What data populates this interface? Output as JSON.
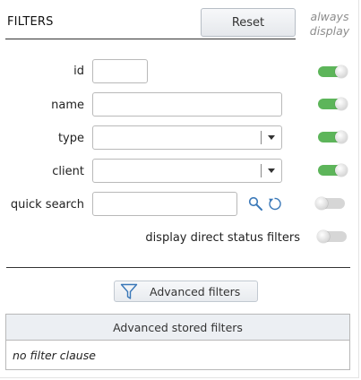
{
  "header": {
    "title": "FILTERS",
    "reset_label": "Reset",
    "always_display_line1": "always",
    "always_display_line2": "display"
  },
  "fields": {
    "id": {
      "label": "id",
      "value": "",
      "always_display": true
    },
    "name": {
      "label": "name",
      "value": "",
      "always_display": true
    },
    "type": {
      "label": "type",
      "selected": "",
      "always_display": true
    },
    "client": {
      "label": "client",
      "selected": "",
      "always_display": true
    },
    "quick_search": {
      "label": "quick search",
      "value": "",
      "always_display": false
    }
  },
  "direct_status": {
    "label": "display direct status filters",
    "enabled": false
  },
  "advanced": {
    "button_label": "Advanced filters"
  },
  "stored_filters": {
    "header": "Advanced stored filters",
    "empty_text": "no filter clause"
  },
  "icons": {
    "search": "magnifier-icon",
    "reset_search": "refresh-icon",
    "advanced": "funnel-icon"
  },
  "colors": {
    "toggle_on": "#5db55a",
    "toggle_off": "#d6d6d6",
    "icon_blue": "#3a78b8"
  }
}
